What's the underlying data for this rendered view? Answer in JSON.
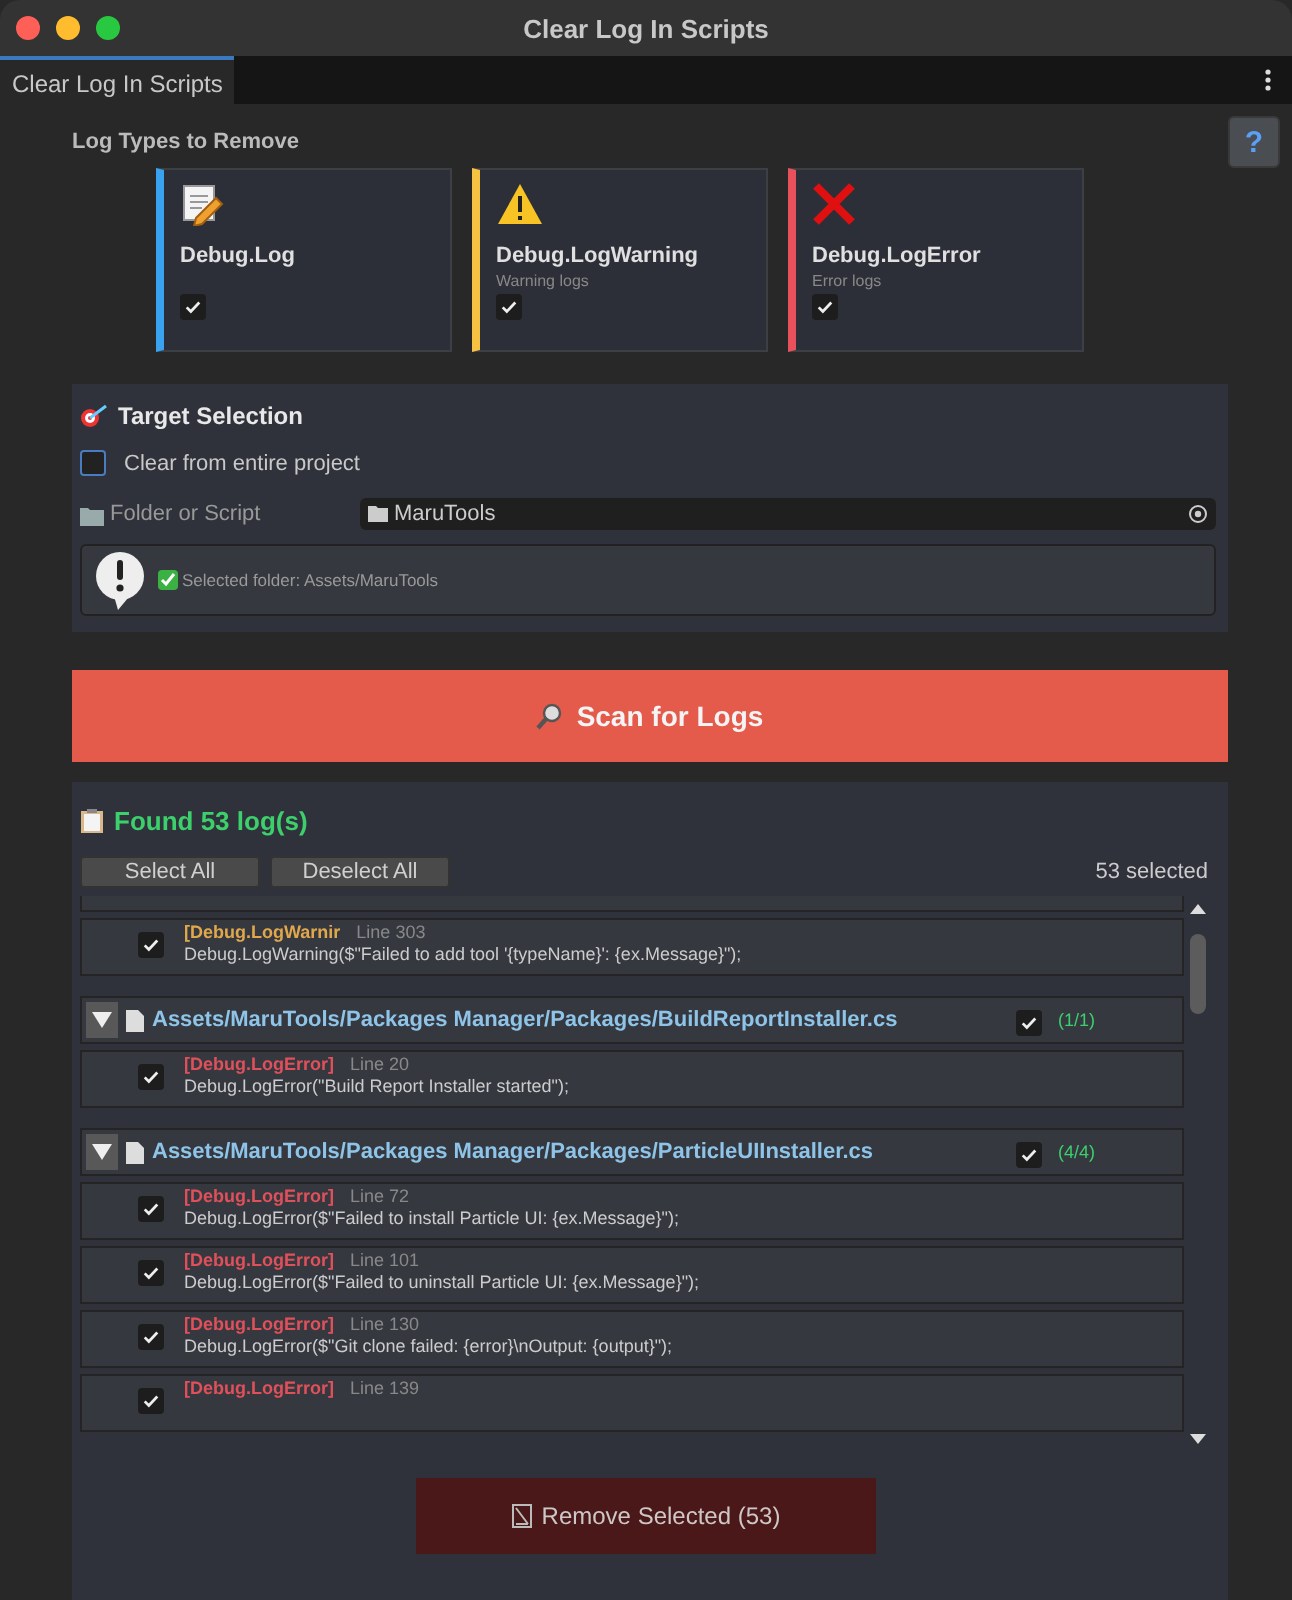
{
  "window": {
    "title": "Clear Log In Scripts"
  },
  "tab": {
    "label": "Clear Log In Scripts",
    "selected": true
  },
  "help_button": "?",
  "log_types": {
    "heading": "Log Types to Remove",
    "items": [
      {
        "kind": "log",
        "name": "Debug.Log",
        "checked": true,
        "color": "#3aa3f0"
      },
      {
        "kind": "warning",
        "name": "Debug.LogWarning",
        "description": "Warning logs",
        "checked": true,
        "color": "#f5c242"
      },
      {
        "kind": "error",
        "name": "Debug.LogError",
        "description": "Error logs",
        "checked": true,
        "color": "#e8505b"
      }
    ]
  },
  "target": {
    "heading": "Target Selection",
    "entire_project": {
      "label": "Clear from entire project",
      "checked": false
    },
    "field_label": "Folder or Script",
    "field_value": "MaruTools",
    "info": "Selected folder: Assets/MaruTools"
  },
  "scan_button": "Scan for Logs",
  "results": {
    "heading": "Found 53 log(s)",
    "select_all": "Select All",
    "deselect_all": "Deselect All",
    "selected_count": "53 selected",
    "groups": [
      {
        "items": [
          {
            "kind": "warning",
            "checked": true,
            "tag": "[Debug.LogWarnir",
            "line": "Line 303",
            "code": "Debug.LogWarning($\"Failed to add tool '{typeName}': {ex.Message}\");"
          }
        ]
      },
      {
        "path": "Assets/MaruTools/Packages Manager/Packages/BuildReportInstaller.cs",
        "checked": true,
        "count": "(1/1)",
        "expanded": true,
        "items": [
          {
            "kind": "error",
            "checked": true,
            "tag": "[Debug.LogError]",
            "line": "Line 20",
            "code": "Debug.LogError(\"Build Report Installer started\");"
          }
        ]
      },
      {
        "path": "Assets/MaruTools/Packages Manager/Packages/ParticleUIInstaller.cs",
        "checked": true,
        "count": "(4/4)",
        "expanded": true,
        "items": [
          {
            "kind": "error",
            "checked": true,
            "tag": "[Debug.LogError]",
            "line": "Line 72",
            "code": "Debug.LogError($\"Failed to install Particle UI: {ex.Message}\");"
          },
          {
            "kind": "error",
            "checked": true,
            "tag": "[Debug.LogError]",
            "line": "Line 101",
            "code": "Debug.LogError($\"Failed to uninstall Particle UI: {ex.Message}\");"
          },
          {
            "kind": "error",
            "checked": true,
            "tag": "[Debug.LogError]",
            "line": "Line 130",
            "code": "Debug.LogError($\"Git clone failed: {error}\\nOutput: {output}\");"
          },
          {
            "kind": "error",
            "checked": true,
            "tag": "[Debug.LogError]",
            "line": "Line 139"
          }
        ]
      }
    ]
  },
  "remove_button": "Remove Selected (53)"
}
